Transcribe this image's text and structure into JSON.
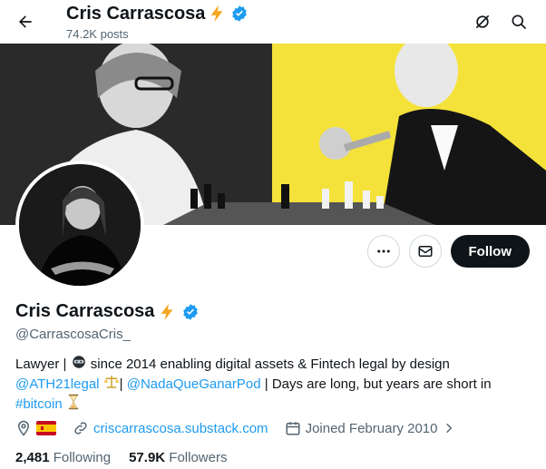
{
  "header": {
    "name": "Cris Carrascosa",
    "posts": "74.2K posts"
  },
  "profile": {
    "display_name": "Cris Carrascosa",
    "handle": "@CarrascosaCris_",
    "bio": {
      "part1": "Lawyer |",
      "part2": "since 2014 enabling digital assets & Fintech legal by design",
      "mention1": "@ATH21legal",
      "sep1": "|",
      "mention2": "@NadaQueGanarPod",
      "part3": "| Days are long, but years are short in",
      "hashtag": "#bitcoin"
    },
    "website": "criscarrascosa.substack.com",
    "joined": "Joined February 2010",
    "following_count": "2,481",
    "following_label": "Following",
    "followers_count": "57.9K",
    "followers_label": "Followers"
  },
  "actions": {
    "follow_label": "Follow"
  },
  "icons": {
    "back": "arrow-left-icon",
    "grok": "slashed-circle-icon",
    "search": "search-icon",
    "more": "more-icon",
    "message": "envelope-icon",
    "location": "location-pin-icon",
    "flag": "spain-flag-icon",
    "link": "link-icon",
    "calendar": "calendar-icon"
  },
  "colors": {
    "accent": "#1d9bf0",
    "verified": "#1d9bf0",
    "follow_bg": "#0f1419",
    "muted_text": "#536471",
    "banner_yellow": "#f4e23a"
  }
}
